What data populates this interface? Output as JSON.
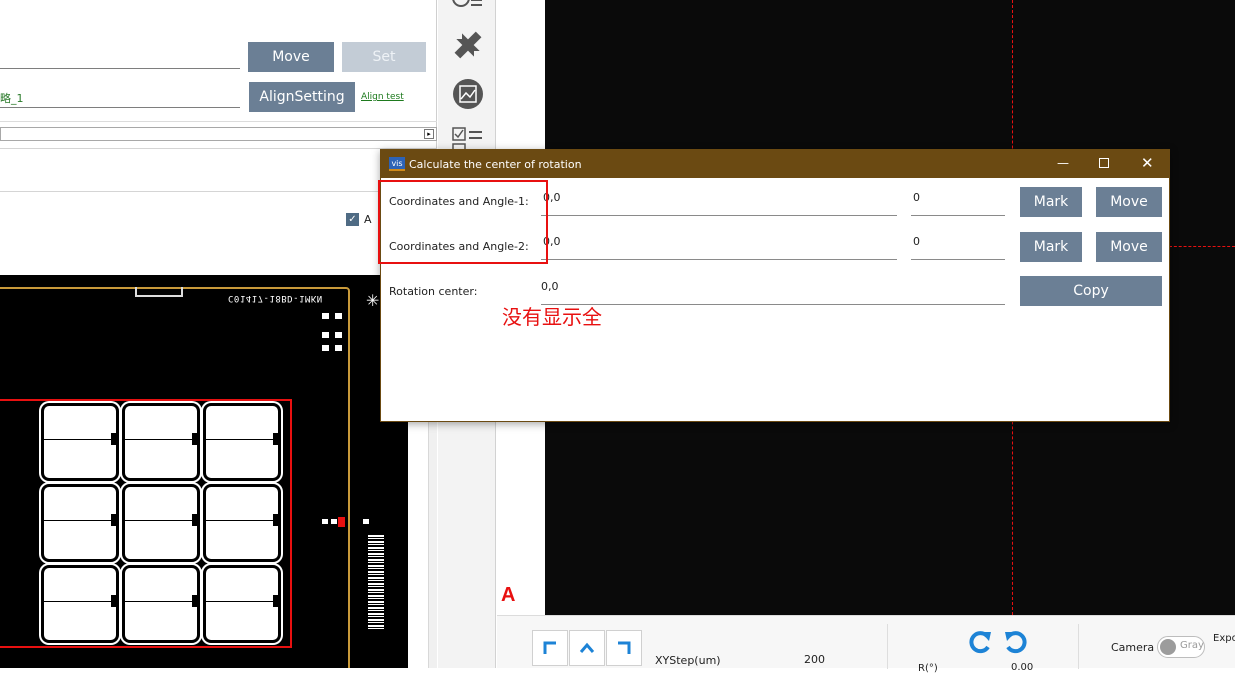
{
  "left_panel": {
    "move_button": "Move",
    "set_button": "Set",
    "recipe_value": "略_1",
    "align_setting_button": "AlignSetting",
    "align_test_link": "Align test",
    "checkbox_label": "A"
  },
  "board": {
    "top_text": "C01417-18BD-1MKN"
  },
  "dialog": {
    "title": "Calculate the center of rotation",
    "icon_text": "vis",
    "row1": {
      "label": "Coordinates and Angle-1:",
      "coords": "0,0",
      "angle": "0",
      "mark": "Mark",
      "move": "Move"
    },
    "row2": {
      "label": "Coordinates and Angle-2:",
      "coords": "0,0",
      "angle": "0",
      "mark": "Mark",
      "move": "Move"
    },
    "row3": {
      "label": "Rotation center:",
      "value": "0,0",
      "copy": "Copy"
    },
    "annotation": "没有显示全",
    "colors": {
      "titlebar": "#6b4a12",
      "highlight": "#e81010"
    }
  },
  "viewer": {
    "marker": "A"
  },
  "bottom": {
    "xystep_label": "XYStep(um)",
    "xystep_value": "200",
    "r_label": "R(°)",
    "r_value": "0.00",
    "camera_label": "Camera",
    "gray_label": "Gray",
    "exposure_label": "Expo"
  },
  "icons": [
    "list-icon",
    "tools-icon",
    "image-icon",
    "checklist-icon",
    "rotate-ccw-icon",
    "rotate-cw-icon",
    "arrow-up-left-icon",
    "arrow-up-icon",
    "arrow-up-right-icon"
  ]
}
